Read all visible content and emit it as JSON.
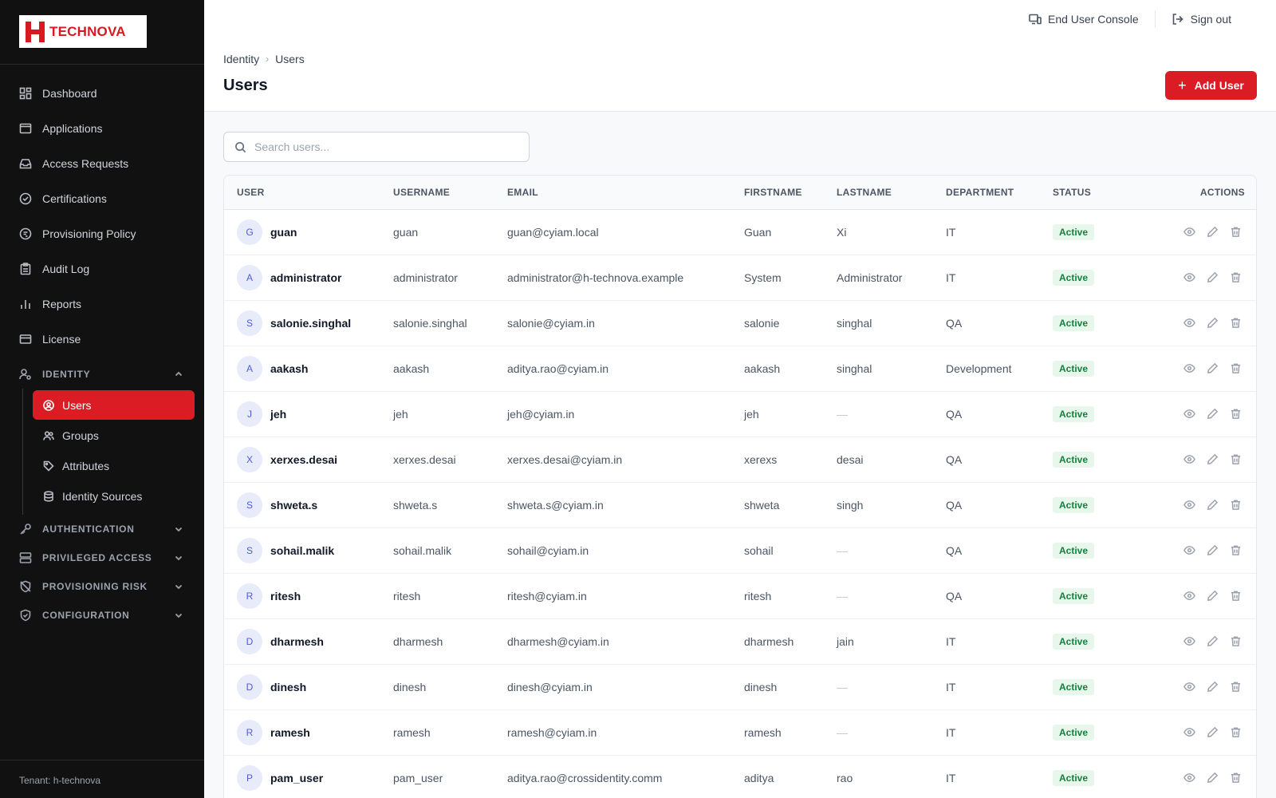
{
  "brand": {
    "name": "TECHNOVA",
    "accent": "#dc1c24"
  },
  "sidebar": {
    "items": [
      {
        "label": "Dashboard",
        "icon": "grid-icon"
      },
      {
        "label": "Applications",
        "icon": "window-icon"
      },
      {
        "label": "Access Requests",
        "icon": "inbox-icon"
      },
      {
        "label": "Certifications",
        "icon": "check-circle-icon"
      },
      {
        "label": "Provisioning Policy",
        "icon": "policy-icon"
      },
      {
        "label": "Audit Log",
        "icon": "clipboard-icon"
      },
      {
        "label": "Reports",
        "icon": "bar-chart-icon"
      },
      {
        "label": "License",
        "icon": "card-icon"
      }
    ],
    "identity_section": "IDENTITY",
    "identity_items": [
      {
        "label": "Users",
        "icon": "user-circle-icon",
        "active": true
      },
      {
        "label": "Groups",
        "icon": "users-icon"
      },
      {
        "label": "Attributes",
        "icon": "tag-icon"
      },
      {
        "label": "Identity Sources",
        "icon": "database-icon"
      }
    ],
    "sections": [
      {
        "label": "AUTHENTICATION",
        "icon": "key-icon"
      },
      {
        "label": "PRIVILEGED ACCESS",
        "icon": "server-icon"
      },
      {
        "label": "PROVISIONING RISK",
        "icon": "shield-off-icon"
      },
      {
        "label": "CONFIGURATION",
        "icon": "shield-check-icon"
      }
    ],
    "tenant": "Tenant: h-technova"
  },
  "topbar": {
    "console_label": "End User Console",
    "signout_label": "Sign out"
  },
  "header": {
    "breadcrumb": [
      "Identity",
      "Users"
    ],
    "title": "Users",
    "add_button": "Add User"
  },
  "search": {
    "placeholder": "Search users..."
  },
  "table": {
    "columns": [
      "USER",
      "USERNAME",
      "EMAIL",
      "FIRSTNAME",
      "LASTNAME",
      "DEPARTMENT",
      "STATUS",
      "ACTIONS"
    ],
    "rows": [
      {
        "initial": "G",
        "user": "guan",
        "username": "guan",
        "email": "guan@cyiam.local",
        "firstname": "Guan",
        "lastname": "Xi",
        "department": "IT",
        "status": "Active"
      },
      {
        "initial": "A",
        "user": "administrator",
        "username": "administrator",
        "email": "administrator@h-technova.example",
        "firstname": "System",
        "lastname": "Administrator",
        "department": "IT",
        "status": "Active"
      },
      {
        "initial": "S",
        "user": "salonie.singhal",
        "username": "salonie.singhal",
        "email": "salonie@cyiam.in",
        "firstname": "salonie",
        "lastname": "singhal",
        "department": "QA",
        "status": "Active"
      },
      {
        "initial": "A",
        "user": "aakash",
        "username": "aakash",
        "email": "aditya.rao@cyiam.in",
        "firstname": "aakash",
        "lastname": "singhal",
        "department": "Development",
        "status": "Active"
      },
      {
        "initial": "J",
        "user": "jeh",
        "username": "jeh",
        "email": "jeh@cyiam.in",
        "firstname": "jeh",
        "lastname": "—",
        "department": "QA",
        "status": "Active"
      },
      {
        "initial": "X",
        "user": "xerxes.desai",
        "username": "xerxes.desai",
        "email": "xerxes.desai@cyiam.in",
        "firstname": "xerexs",
        "lastname": "desai",
        "department": "QA",
        "status": "Active"
      },
      {
        "initial": "S",
        "user": "shweta.s",
        "username": "shweta.s",
        "email": "shweta.s@cyiam.in",
        "firstname": "shweta",
        "lastname": "singh",
        "department": "QA",
        "status": "Active"
      },
      {
        "initial": "S",
        "user": "sohail.malik",
        "username": "sohail.malik",
        "email": "sohail@cyiam.in",
        "firstname": "sohail",
        "lastname": "—",
        "department": "QA",
        "status": "Active"
      },
      {
        "initial": "R",
        "user": "ritesh",
        "username": "ritesh",
        "email": "ritesh@cyiam.in",
        "firstname": "ritesh",
        "lastname": "—",
        "department": "QA",
        "status": "Active"
      },
      {
        "initial": "D",
        "user": "dharmesh",
        "username": "dharmesh",
        "email": "dharmesh@cyiam.in",
        "firstname": "dharmesh",
        "lastname": "jain",
        "department": "IT",
        "status": "Active"
      },
      {
        "initial": "D",
        "user": "dinesh",
        "username": "dinesh",
        "email": "dinesh@cyiam.in",
        "firstname": "dinesh",
        "lastname": "—",
        "department": "IT",
        "status": "Active"
      },
      {
        "initial": "R",
        "user": "ramesh",
        "username": "ramesh",
        "email": "ramesh@cyiam.in",
        "firstname": "ramesh",
        "lastname": "—",
        "department": "IT",
        "status": "Active"
      },
      {
        "initial": "P",
        "user": "pam_user",
        "username": "pam_user",
        "email": "aditya.rao@crossidentity.comm",
        "firstname": "aditya",
        "lastname": "rao",
        "department": "IT",
        "status": "Active"
      }
    ]
  }
}
